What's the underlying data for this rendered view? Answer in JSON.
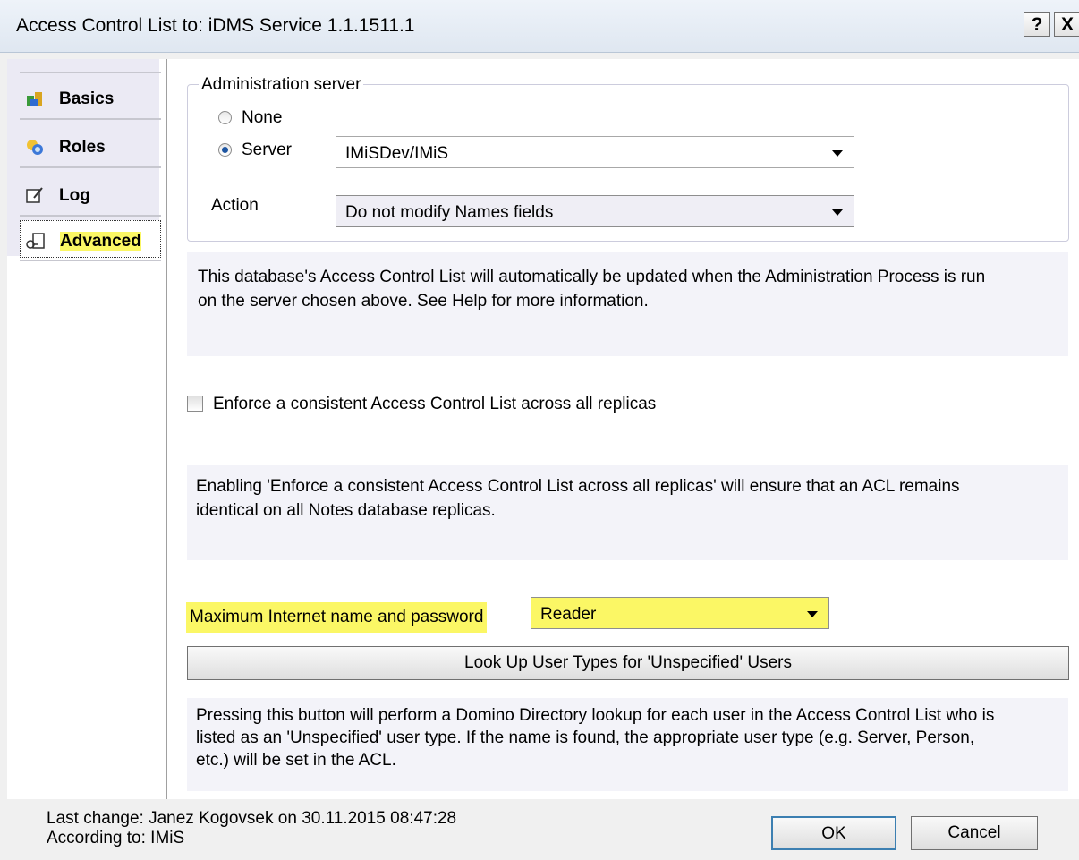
{
  "window": {
    "title": "Access Control List to: iDMS Service 1.1.1511.1",
    "help_label": "?",
    "close_label": "X"
  },
  "nav": {
    "items": [
      {
        "label": "Basics",
        "icon": "people-icon"
      },
      {
        "label": "Roles",
        "icon": "roles-icon"
      },
      {
        "label": "Log",
        "icon": "log-icon"
      },
      {
        "label": "Advanced",
        "icon": "advanced-icon"
      }
    ],
    "selected": "Advanced"
  },
  "admin": {
    "legend": "Administration server",
    "radio_none": "None",
    "radio_server": "Server",
    "server_value": "IMiSDev/IMiS",
    "action_label": "Action",
    "action_value": "Do not modify Names fields",
    "info_line1": "This database's Access Control List will automatically be updated when the Administration Process is run",
    "info_line2": "on the server chosen above. See Help for more information."
  },
  "enforce": {
    "checkbox_label": "Enforce a consistent Access Control List across all replicas",
    "checked": false,
    "info_line1": "Enabling 'Enforce a consistent Access Control List across all replicas' will ensure that an ACL remains",
    "info_line2": "identical on all Notes database replicas."
  },
  "internet": {
    "label": "Maximum Internet name and password",
    "value": "Reader"
  },
  "lookup": {
    "button_label": "Look Up User Types for 'Unspecified' Users",
    "info_line1": "Pressing this button will perform a Domino Directory lookup for each user in the Access Control List who is",
    "info_line2": "listed as an 'Unspecified' user type.  If the name is found, the appropriate user type (e.g. Server, Person,",
    "info_line3": "etc.) will be set in the ACL."
  },
  "footer": {
    "last_change": "Last change: Janez Kogovsek on 30.11.2015 08:47:28",
    "according_to": "According to: IMiS",
    "ok_label": "OK",
    "cancel_label": "Cancel"
  },
  "colors": {
    "highlight": "#fbf765",
    "radio_selected": "#1d55a1"
  }
}
